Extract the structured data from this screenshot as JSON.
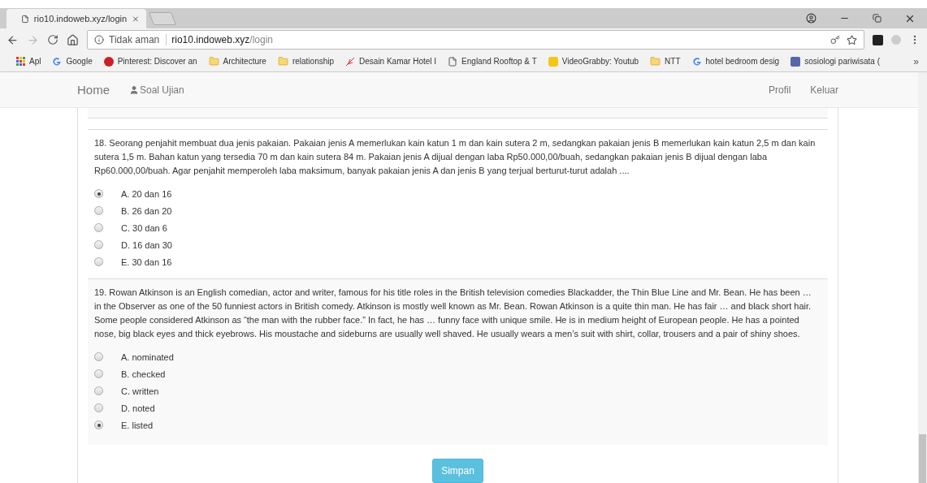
{
  "browser": {
    "tab": {
      "title": "rio10.indoweb.xyz/login"
    },
    "address": {
      "security": "Tidak aman",
      "host": "rio10.indoweb.xyz",
      "path": "/login"
    },
    "bookmarks": [
      {
        "kind": "apps",
        "label": "Apl"
      },
      {
        "kind": "google",
        "label": "Google"
      },
      {
        "kind": "pinterest",
        "label": "Pinterest: Discover an"
      },
      {
        "kind": "folder",
        "label": "Architecture"
      },
      {
        "kind": "folder",
        "label": "relationship"
      },
      {
        "kind": "feather",
        "label": "Desain Kamar Hotel I"
      },
      {
        "kind": "page",
        "label": "England Rooftop & T"
      },
      {
        "kind": "hand",
        "label": "VideoGrabby: Youtub"
      },
      {
        "kind": "folder",
        "label": "NTT"
      },
      {
        "kind": "google",
        "label": "hotel bedroom desig"
      },
      {
        "kind": "avatar",
        "label": "sosiologi pariwisata ("
      }
    ],
    "more": "»"
  },
  "nav": {
    "brand": "Home",
    "items": [
      {
        "label": "Soal Ujian"
      }
    ],
    "right": [
      {
        "label": "Profil"
      },
      {
        "label": "Keluar"
      }
    ]
  },
  "questions": [
    {
      "text": "18. Seorang penjahit membuat dua jenis pakaian. Pakaian jenis A memerlukan kain katun 1 m dan kain sutera 2 m, sedangkan pakaian jenis B memerlukan kain katun 2,5 m dan kain sutera 1,5 m. Bahan katun yang tersedia 70 m dan kain sutera 84 m. Pakaian jenis A dijual dengan laba Rp50.000,00/buah, sedangkan pakaian jenis B dijual dengan laba Rp60.000,00/buah. Agar penjahit memperoleh laba maksimum, banyak pakaian jenis A dan jenis B yang terjual berturut-turut adalah ....",
      "striped": false,
      "options": [
        {
          "label": "A. 20 dan 16",
          "selected": true
        },
        {
          "label": "B. 26 dan 20",
          "selected": false
        },
        {
          "label": "C. 30 dan 6",
          "selected": false
        },
        {
          "label": "D. 16 dan 30",
          "selected": false
        },
        {
          "label": "E. 30 dan 16",
          "selected": false
        }
      ]
    },
    {
      "text": "19. Rowan Atkinson is an English comedian, actor and writer, famous for his title roles in the British television comedies Blackadder, the Thin Blue Line and Mr. Bean. He has been … in the Observer as one of the 50 funniest actors in British comedy. Atkinson is mostly well known as Mr. Bean. Rowan Atkinson is a quite thin man. He has fair … and black short hair. Some people considered Atkinson as “the man with the rubber face.” In fact, he has … funny face with unique smile. He is in medium height of European people. He has a pointed nose, big black eyes and thick eyebrows. His moustache and sideburns are usually well shaved. He usually wears a men’s suit with shirt, collar, trousers and a pair of shiny shoes.",
      "striped": true,
      "options": [
        {
          "label": "A. nominated",
          "selected": false
        },
        {
          "label": "B. checked",
          "selected": false
        },
        {
          "label": "C. written",
          "selected": false
        },
        {
          "label": "D. noted",
          "selected": false
        },
        {
          "label": "E. listed",
          "selected": true
        }
      ]
    }
  ],
  "submit": "Simpan"
}
